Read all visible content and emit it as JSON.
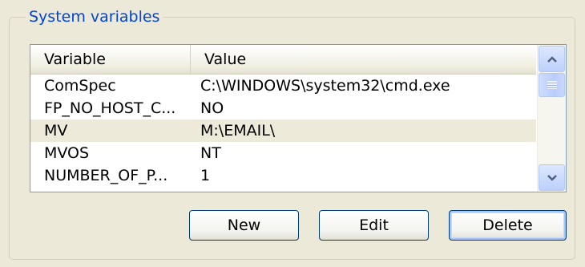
{
  "group": {
    "title": "System variables"
  },
  "listview": {
    "columns": [
      {
        "label": "Variable"
      },
      {
        "label": "Value"
      }
    ],
    "rows": [
      {
        "variable": "ComSpec",
        "value": "C:\\WINDOWS\\system32\\cmd.exe",
        "selected": false
      },
      {
        "variable": "FP_NO_HOST_C...",
        "value": "NO",
        "selected": false
      },
      {
        "variable": "MV",
        "value": "M:\\EMAIL\\",
        "selected": true
      },
      {
        "variable": "MVOS",
        "value": "NT",
        "selected": false
      },
      {
        "variable": "NUMBER_OF_P...",
        "value": "1",
        "selected": false
      }
    ],
    "scrollbar": {
      "position_fraction": 0.0,
      "up_icon": "chevron-up-icon",
      "down_icon": "chevron-down-icon"
    }
  },
  "buttons": {
    "new_label": "New",
    "edit_label": "Edit",
    "delete_label": "Delete"
  },
  "colors": {
    "group_title": "#0046d5",
    "selection": "#edead9",
    "button_border": "#003c74",
    "background": "#ece9d8"
  }
}
